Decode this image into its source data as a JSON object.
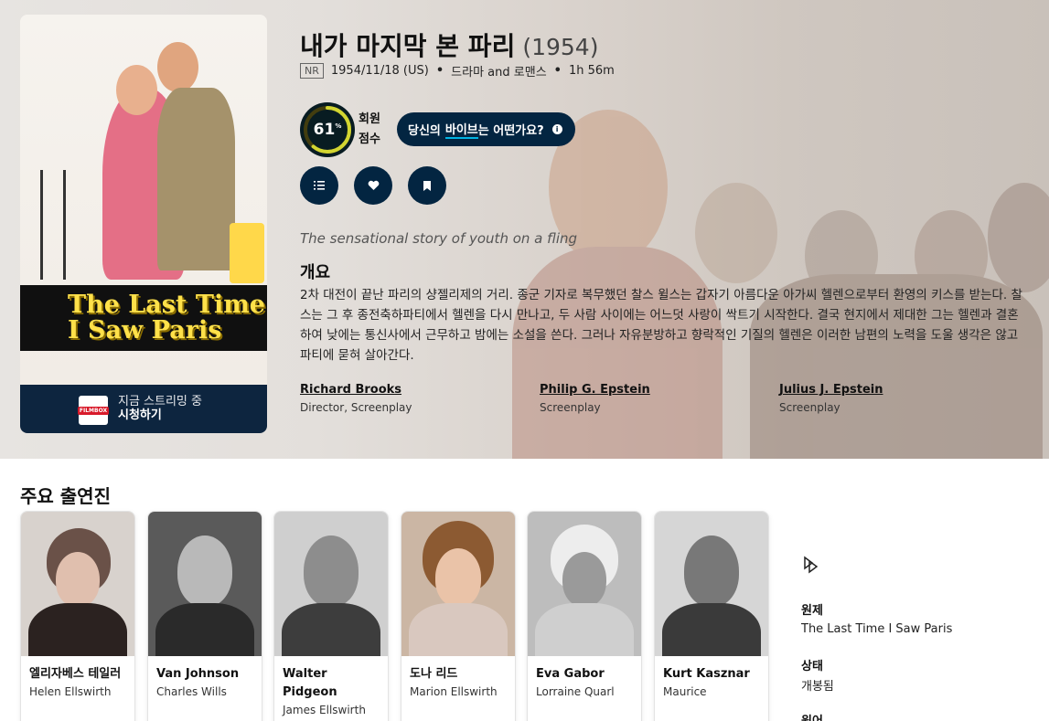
{
  "movie": {
    "title": "내가 마지막 본 파리",
    "year": "(1954)",
    "certification": "NR",
    "release": "1954/11/18 (US)",
    "genres": "드라마 and 로맨스",
    "runtime": "1h 56m",
    "score": 61,
    "score_text": "61",
    "score_unit": "%",
    "score_label_line1": "회원",
    "score_label_line2": "점수",
    "vibe_prefix": "당신의 ",
    "vibe_highlight": "바이브",
    "vibe_suffix": "는 어떤가요?",
    "tagline": "The sensational story of youth on a fling",
    "overview_heading": "개요",
    "overview": "2차 대전이 끝난 파리의 샹젤리제의 거리. 종군 기자로 복무했던 찰스 윌스는 갑자기 아름다운 아가씨 헬렌으로부터 환영의 키스를 받는다. 찰스는 그 후 종전축하파티에서 헬렌을 다시 만나고, 두 사람 사이에는 어느덧 사랑이 싹트기 시작한다. 결국 현지에서 제대한 그는 헬렌과 결혼하여 낮에는 통신사에서 근무하고 밤에는 소설을 쓴다. 그러나 자유분방하고 향락적인 기질의 헬렌은 이러한 남편의 노력을 도울 생각은 않고 파티에 묻혀 살아간다."
  },
  "poster": {
    "title_line1": "The Last Time",
    "title_line2": "I Saw Paris"
  },
  "streaming": {
    "provider_logo": "FILMBOX",
    "line1": "지금 스트리밍 중",
    "line2": "시청하기"
  },
  "crew": [
    {
      "name": "Richard Brooks",
      "job": "Director, Screenplay"
    },
    {
      "name": "Philip G. Epstein",
      "job": "Screenplay"
    },
    {
      "name": "Julius J. Epstein",
      "job": "Screenplay"
    }
  ],
  "cast_heading": "주요 출연진",
  "cast": [
    {
      "name": "엘리자베스 테일러",
      "role": "Helen Ellswirth"
    },
    {
      "name": "Van Johnson",
      "role": "Charles Wills"
    },
    {
      "name": "Walter Pidgeon",
      "role": "James Ellswirth"
    },
    {
      "name": "도나 리드",
      "role": "Marion Ellswirth"
    },
    {
      "name": "Eva Gabor",
      "role": "Lorraine Quarl"
    },
    {
      "name": "Kurt Kasznar",
      "role": "Maurice"
    }
  ],
  "side": {
    "original_title_label": "원제",
    "original_title": "The Last Time I Saw Paris",
    "status_label": "상태",
    "status": "개봉됨",
    "language_label": "원어"
  },
  "icons": {
    "list": "list-icon",
    "favorite": "heart-icon",
    "watchlist": "bookmark-icon",
    "info": "info-icon",
    "justwatch": "play-arrows-icon"
  },
  "colors": {
    "navy": "#032541",
    "score_ring": "#d2d531",
    "accent": "#01b4e4"
  }
}
